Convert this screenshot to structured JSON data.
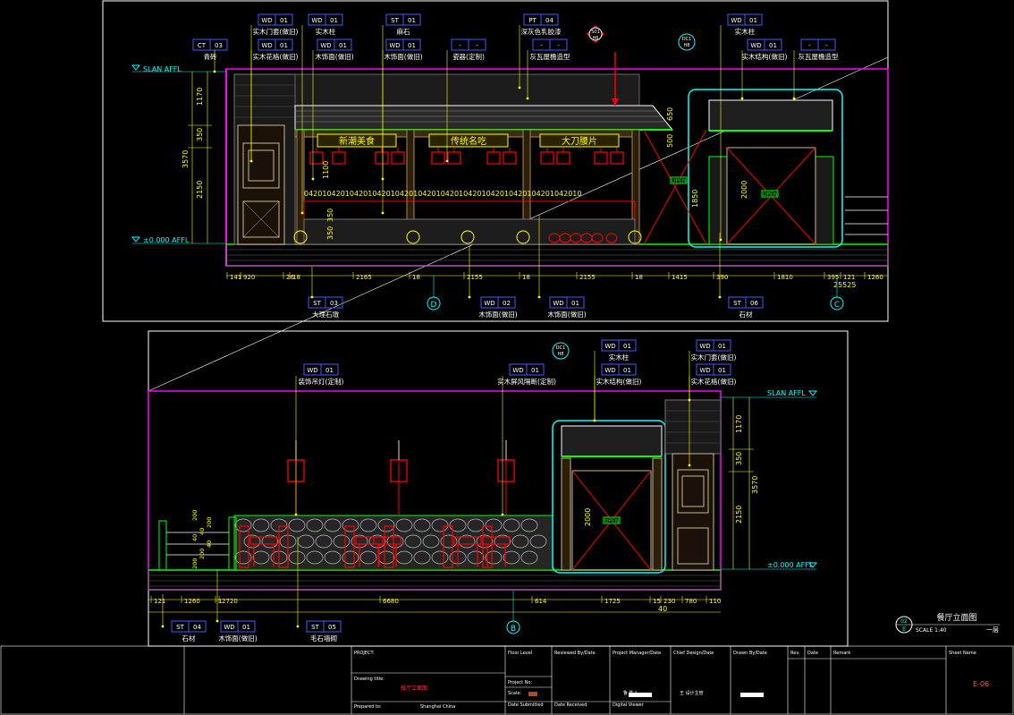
{
  "colors": {
    "background": "#000000",
    "frame": "#ffffff",
    "dimension": "#ffff00",
    "tag": "#1f4dff",
    "tag_text": "#ffffff",
    "wood": "#00ff00",
    "accent": "#ff00ff",
    "red": "#ff0000",
    "cyan": "#00ffff",
    "grey": "#9a9a9a"
  },
  "top": {
    "tags": [
      {
        "code": "WD",
        "num": "01",
        "note": "实木门套(做旧)"
      },
      {
        "code": "WD",
        "num": "01",
        "note": "实木柱"
      },
      {
        "code": "ST",
        "num": "01",
        "note": "麻石"
      },
      {
        "code": "PT",
        "num": "04",
        "note": "深灰色乳胶漆"
      },
      {
        "code": "WD",
        "num": "01",
        "note": "实木柱"
      },
      {
        "code": "CT",
        "num": "03",
        "note": "青砖"
      },
      {
        "code": "WD",
        "num": "01",
        "note": "实木花格(做旧)"
      },
      {
        "code": "WD",
        "num": "01",
        "note": "木饰面(做旧)"
      },
      {
        "code": "WD",
        "num": "01",
        "note": "木饰面(做旧)"
      },
      {
        "code": "-",
        "num": "-",
        "note": "瓷器(定制)"
      },
      {
        "code": "-",
        "num": "-",
        "note": "灰瓦屋檐造型"
      },
      {
        "code": "WD",
        "num": "01",
        "note": "实木结构(做旧)"
      },
      {
        "code": "-",
        "num": "-",
        "note": "灰瓦屋檐造型"
      }
    ],
    "bottom_tags": [
      {
        "code": "ST",
        "num": "03",
        "note": "大理石墩"
      },
      {
        "code": "WD",
        "num": "02",
        "note": "木饰面(做旧)"
      },
      {
        "code": "WD",
        "num": "01",
        "note": "木饰面(做旧)"
      },
      {
        "code": "ST",
        "num": "06",
        "note": "石材"
      }
    ],
    "level_top": "SLAN AFFL",
    "level_bottom": "±0.000 AFFL",
    "signs": [
      "新潮美食",
      "传统名吃",
      "大刀腰片"
    ],
    "section_marker": {
      "id": "S01",
      "sheet": "H6"
    },
    "door_marker": {
      "id": "DC1",
      "sheet": "H8"
    },
    "open_label": "OPEN",
    "vdims": [
      "1170",
      "350",
      "3570",
      "2150"
    ],
    "inner_vdims": [
      "1100",
      "350",
      "350"
    ],
    "door_vdims": [
      "650",
      "500",
      "1850",
      "2000"
    ],
    "shelf_dims": "0420104201042010420104201042010420104201042010420104201042010",
    "hdims": [
      "141",
      "920",
      "26",
      "18",
      "2165",
      "18",
      "2155",
      "18",
      "2155",
      "18",
      "1415",
      "390",
      "1810",
      "395",
      "121",
      "1260"
    ],
    "hdim_total": "25525",
    "grid_d": "D",
    "grid_c": "C"
  },
  "bottom": {
    "tags": [
      {
        "code": "WD",
        "num": "01",
        "note": "装饰吊灯(定制)"
      },
      {
        "code": "WD",
        "num": "01",
        "note": "实木屏风隔断(定制)"
      },
      {
        "code": "WD",
        "num": "01",
        "note": "实木柱"
      },
      {
        "code": "WD",
        "num": "01",
        "note": "实木结构(做旧)"
      },
      {
        "code": "WD",
        "num": "01",
        "note": "实木门套(做旧)"
      },
      {
        "code": "WD",
        "num": "01",
        "note": "实木花格(做旧)"
      }
    ],
    "bottom_tags": [
      {
        "code": "ST",
        "num": "04",
        "note": "石材"
      },
      {
        "code": "WD",
        "num": "01",
        "note": "木饰面(做旧)"
      },
      {
        "code": "ST",
        "num": "05",
        "note": "毛石墙砌"
      }
    ],
    "level_top": "SLAN AFFL",
    "level_bottom": "±0.000 AFFL",
    "door_marker": {
      "id": "DC1",
      "sheet": "H8"
    },
    "open_label": "OPEN",
    "vdims": [
      "1170",
      "350",
      "3570",
      "2150"
    ],
    "door_vdim": "2000",
    "left_vdims": [
      "200",
      "200",
      "40",
      "40",
      "40",
      "200",
      "200"
    ],
    "hdims": [
      "121",
      "1260",
      "1",
      "2720",
      "6680",
      "614",
      "1725",
      "15",
      "230",
      "780",
      "110"
    ],
    "hdim_total": "40",
    "grid_b": "B",
    "view_no": "02",
    "view_grid": "E",
    "view_title": "餐厅立面图",
    "scale": "SCALE 1:40",
    "floor": "一层"
  },
  "title_block": {
    "project_label": "PROJECT:",
    "drawing_title_label": "Drawing title:",
    "drawing_title": "餐厅立面图",
    "prepared_label": "Prepared to:",
    "prepared_value": "Shanghai China",
    "floor_level": "Floor Level",
    "project_no": "Project No:",
    "scale_label": "Scale:",
    "date_submitted": "Date Submitted",
    "reviewed": "Reviewed By/Date",
    "date_received": "Date Received",
    "pm": "Project Manager/Date",
    "pm_value": "鲁 陈人",
    "digital": "Digital Viewer",
    "chief": "Chief Design/Date",
    "chief_value": "王 设计主管",
    "drawn": "Drawn By/Date",
    "rev": "Rev.",
    "date": "Date",
    "remark": "Remark",
    "sheet_name": "Sheet Name",
    "sheet_no": "E-06"
  }
}
